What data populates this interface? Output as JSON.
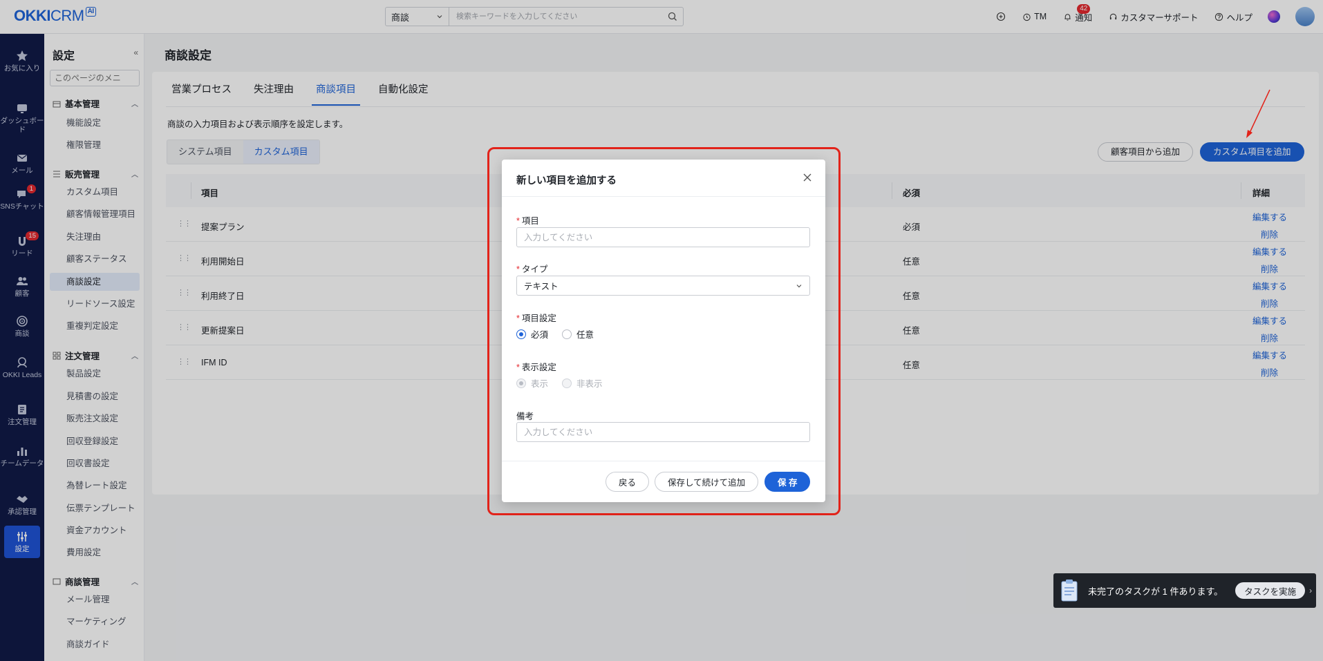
{
  "brand": {
    "name_bold": "OKKI",
    "name_light": "CRM",
    "ai_tag": "AI"
  },
  "search": {
    "scope": "商談",
    "placeholder": "検索キーワードを入力してください"
  },
  "top_actions": {
    "tm": "TM",
    "notify": "通知",
    "notify_count": "42",
    "support": "カスタマーサポート",
    "help": "ヘルプ"
  },
  "nav": {
    "favorites": "お気に入り",
    "dashboard": "ダッシュボード",
    "mail": "メール",
    "sns": "SNSチャット",
    "sns_count": "1",
    "lead": "リード",
    "lead_count": "15",
    "customer": "顧客",
    "deal": "商談",
    "okki_leads": "OKKI Leads",
    "order": "注文管理",
    "team": "チームデータ",
    "approval": "承認管理",
    "settings": "設定"
  },
  "menu": {
    "title": "設定",
    "search_placeholder": "このページのメニ",
    "groups": {
      "basic": "基本管理",
      "sales": "販売管理",
      "order": "注文管理",
      "deal": "商談管理"
    },
    "items": {
      "func": "機能設定",
      "perm": "権限管理",
      "custom": "カスタム項目",
      "custinfo": "顧客情報管理項目",
      "lostreason": "失注理由",
      "custstatus": "顧客ステータス",
      "dealset": "商談設定",
      "leadsource": "リードソース設定",
      "dup": "重複判定設定",
      "product": "製品設定",
      "quote": "見積書の設定",
      "salesorder": "販売注文設定",
      "collect": "回収登録設定",
      "collectdoc": "回収書設定",
      "fx": "為替レート設定",
      "template": "伝票テンプレート",
      "fund": "資金アカウント",
      "cost": "費用設定",
      "mailmgmt": "メール管理",
      "marketing": "マーケティング",
      "guide": "商談ガイド"
    }
  },
  "page": {
    "title": "商談設定",
    "tabs": [
      "営業プロセス",
      "失注理由",
      "商談項目",
      "自動化設定"
    ],
    "description": "商談の入力項目および表示順序を設定します。",
    "subtabs": [
      "システム項目",
      "カスタム項目"
    ],
    "btn_from_customer": "顧客項目から追加",
    "btn_add_custom": "カスタム項目を追加"
  },
  "table": {
    "headers": {
      "item": "項目",
      "required": "必須",
      "detail": "詳細"
    },
    "rows": [
      {
        "name": "提案プラン",
        "required": "必須"
      },
      {
        "name": "利用開始日",
        "required": "任意"
      },
      {
        "name": "利用終了日",
        "required": "任意"
      },
      {
        "name": "更新提案日",
        "required": "任意"
      },
      {
        "name": "IFM ID",
        "required": "任意"
      }
    ],
    "edit_label": "編集する",
    "delete_label": "削除"
  },
  "modal": {
    "title": "新しい項目を追加する",
    "field_item": "項目",
    "field_item_placeholder": "入力してください",
    "field_type": "タイプ",
    "field_type_value": "テキスト",
    "field_setting": "項目設定",
    "opt_required": "必須",
    "opt_optional": "任意",
    "field_display": "表示設定",
    "opt_show": "表示",
    "opt_hide": "非表示",
    "field_note": "備考",
    "field_note_placeholder": "入力してください",
    "btn_back": "戻る",
    "btn_save_continue": "保存して続けて追加",
    "btn_save": "保 存"
  },
  "task": {
    "text": "未完了のタスクが 1 件あります。",
    "button": "タスクを実施"
  }
}
